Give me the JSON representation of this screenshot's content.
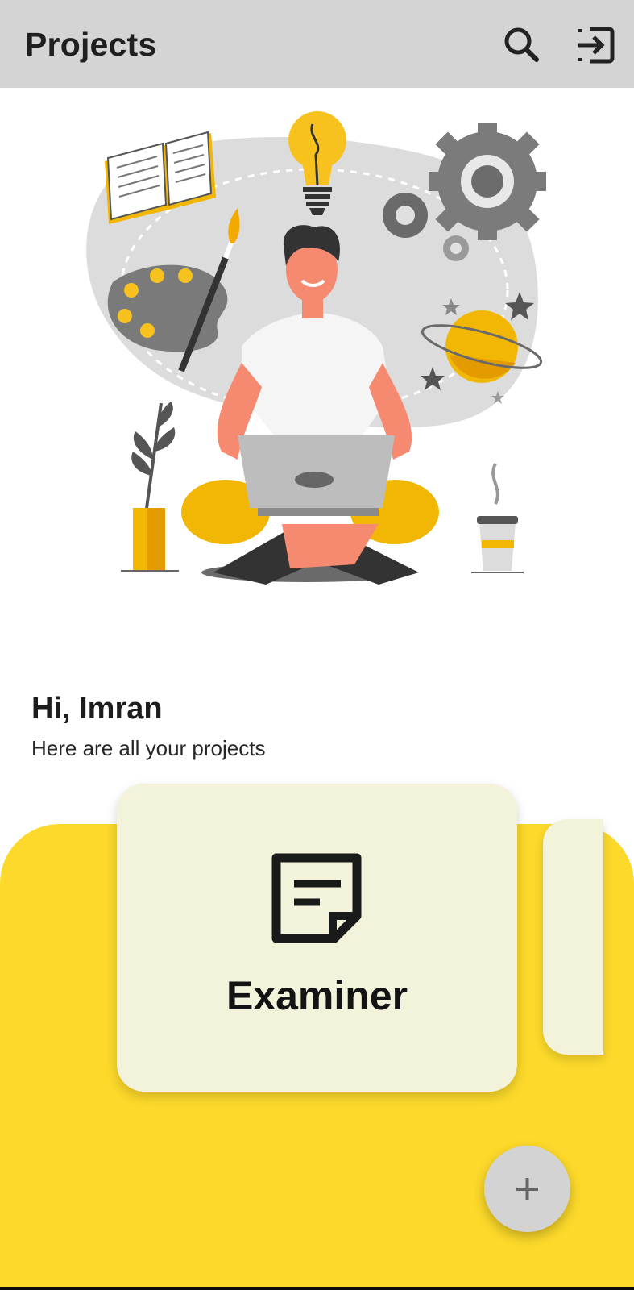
{
  "appbar": {
    "title": "Projects",
    "icons": {
      "search": "search-icon",
      "logout": "logout-icon"
    }
  },
  "greeting": {
    "title": "Hi, Imran",
    "subtitle": "Here are all your projects"
  },
  "projects": [
    {
      "name": "Examiner",
      "icon": "sticky-note-icon"
    }
  ],
  "fab": {
    "icon": "plus-icon"
  },
  "colors": {
    "appbar": "#d4d4d4",
    "panel": "#fcd92a",
    "card": "#f3f3dc",
    "fab": "#d3d3d3"
  }
}
